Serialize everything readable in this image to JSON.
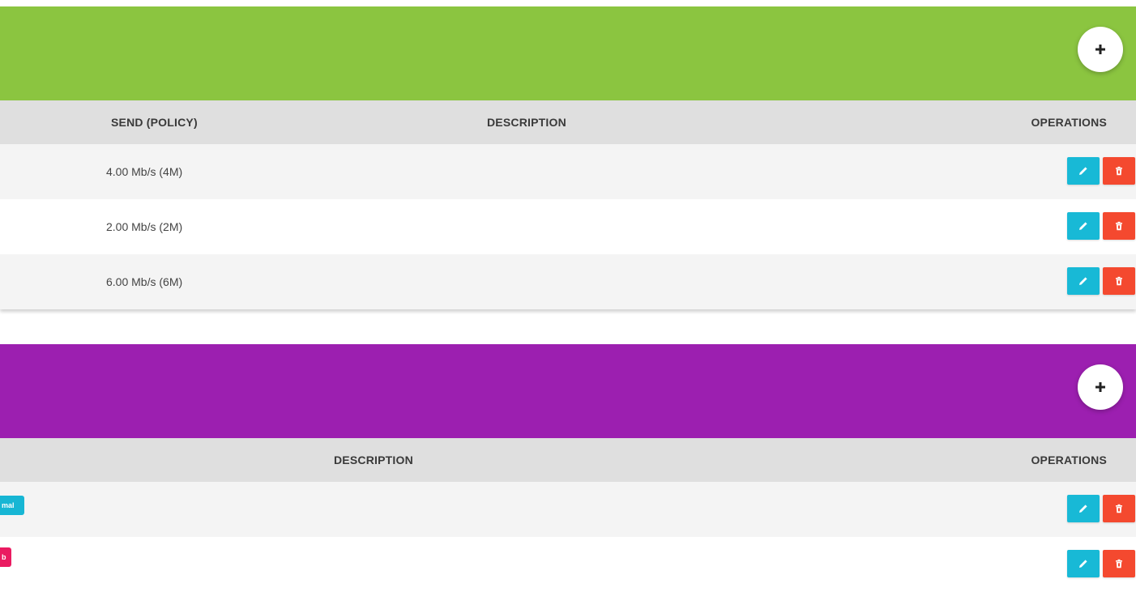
{
  "colors": {
    "card1_header": "#8bc540",
    "card2_header": "#9c1fb0",
    "edit": "#18b9d6",
    "delete": "#f4492f",
    "tag_cyan": "#17b6d4",
    "tag_pink": "#ea1b61"
  },
  "card1": {
    "add_icon": "plus-icon",
    "columns": {
      "send": "SEND (POLICY)",
      "description": "DESCRIPTION",
      "operations": "OPERATIONS"
    },
    "rows": [
      {
        "send": "4.00 Mb/s (4M)",
        "description": ""
      },
      {
        "send": "2.00 Mb/s (2M)",
        "description": ""
      },
      {
        "send": "6.00 Mb/s (6M)",
        "description": ""
      }
    ]
  },
  "card2": {
    "add_icon": "plus-icon",
    "columns": {
      "description": "DESCRIPTION",
      "operations": "OPERATIONS"
    },
    "rows": [
      {
        "tag": "mal",
        "tag_color": "cyan",
        "description": ""
      },
      {
        "tag": "b",
        "tag_color": "pink",
        "description": ""
      }
    ]
  },
  "icons": {
    "edit": "pencil-icon",
    "delete": "trash-icon"
  }
}
